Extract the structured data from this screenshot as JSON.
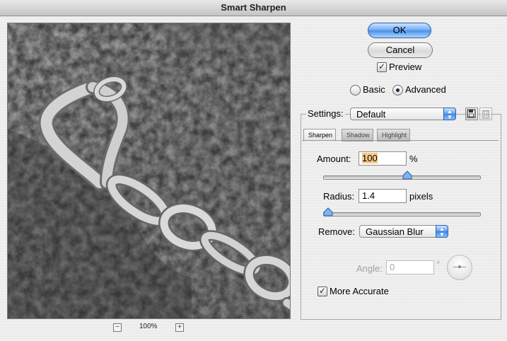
{
  "window": {
    "title": "Smart Sharpen"
  },
  "preview": {
    "zoom": "100%",
    "zoom_out_symbol": "−",
    "zoom_in_symbol": "+"
  },
  "buttons": {
    "ok": "OK",
    "cancel": "Cancel"
  },
  "preview_checkbox": {
    "label": "Preview",
    "checked": true
  },
  "mode": {
    "options": [
      "Basic",
      "Advanced"
    ],
    "selected": "Advanced"
  },
  "settings": {
    "label": "Settings:",
    "value": "Default"
  },
  "tabs": [
    {
      "label": "Sharpen",
      "active": true
    },
    {
      "label": "Shadow",
      "active": false
    },
    {
      "label": "Highlight",
      "active": false
    }
  ],
  "amount": {
    "label": "Amount:",
    "value": "100",
    "unit": "%",
    "slider_fraction": 0.5
  },
  "radius": {
    "label": "Radius:",
    "value": "1.4",
    "unit": "pixels",
    "slider_fraction": 0.02
  },
  "remove": {
    "label": "Remove:",
    "value": "Gaussian Blur"
  },
  "angle": {
    "label": "Angle:",
    "value": "0",
    "unit": "°",
    "enabled": false
  },
  "more_accurate": {
    "label": "More Accurate",
    "checked": true
  },
  "colors": {
    "accent_blue": "#4a90ea",
    "highlight_field": "#f7c98a"
  }
}
